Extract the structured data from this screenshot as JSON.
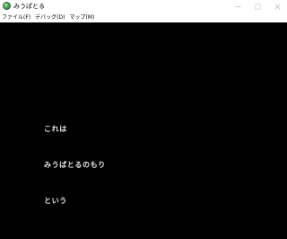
{
  "window": {
    "title": "みうぱとる",
    "icon": "app-globe-icon"
  },
  "controls": {
    "minimize": "minimize-icon",
    "maximize": "maximize-icon",
    "close": "close-icon"
  },
  "menu": [
    {
      "label": "ファイル(F)"
    },
    {
      "label": "デバッグ(D)"
    },
    {
      "label": "マップ(M)"
    }
  ],
  "game": {
    "background": "#000000",
    "text_color": "#e6e6e6",
    "lines": [
      {
        "text": "これは"
      },
      {
        "text": "みうぱとるのもり"
      },
      {
        "text": "という"
      }
    ]
  }
}
